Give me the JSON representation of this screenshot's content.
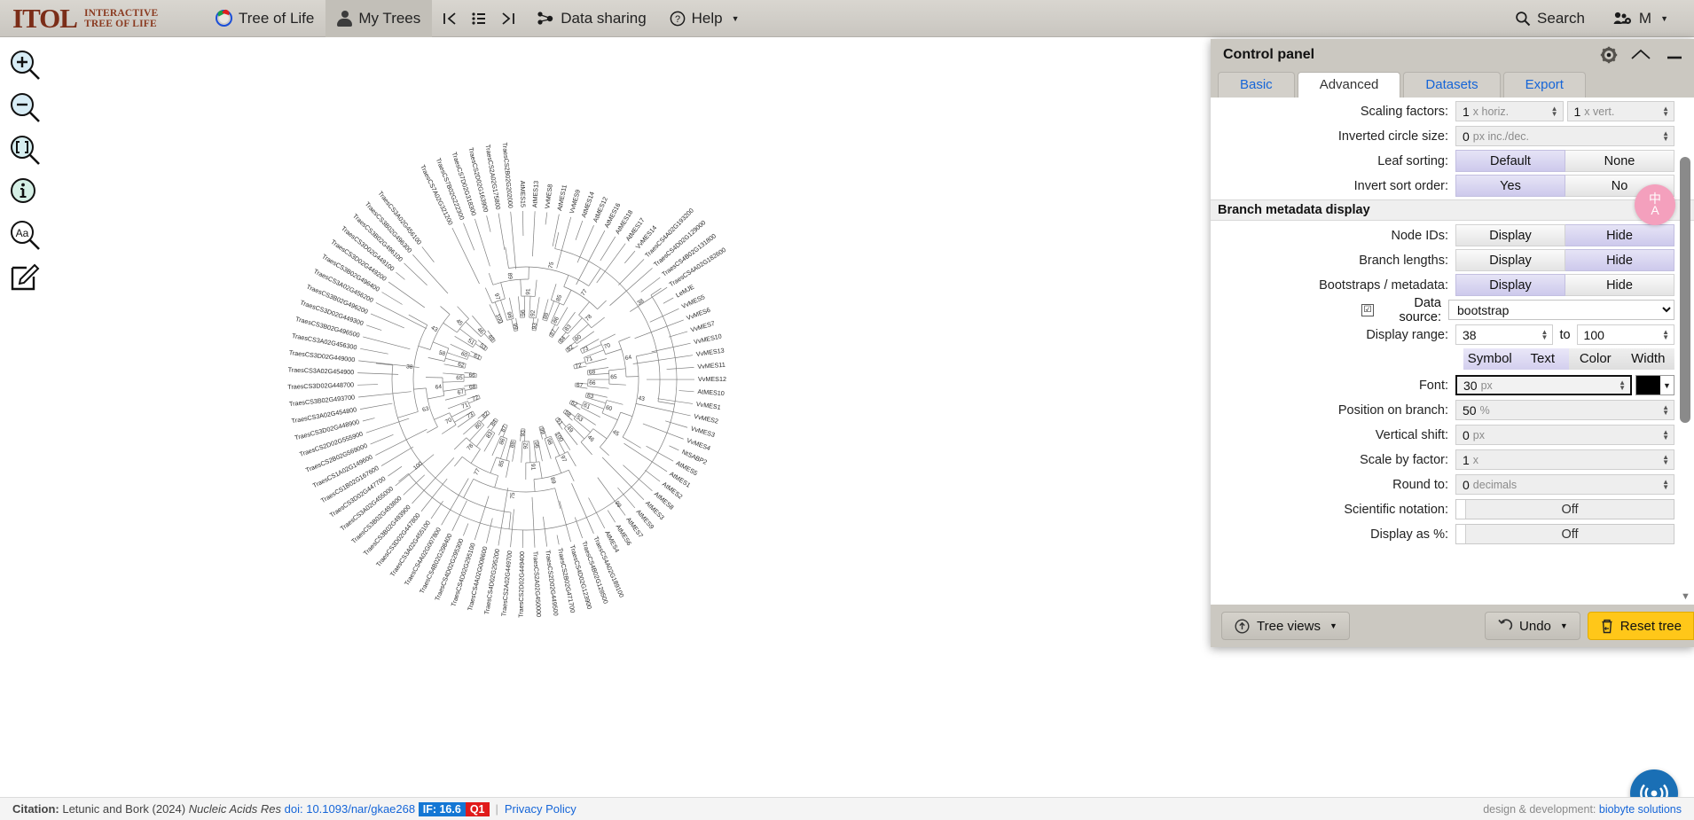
{
  "app": {
    "logo_main": "ITOL",
    "logo_line1": "INTERACTIVE",
    "logo_line2": "TREE OF LIFE"
  },
  "nav": {
    "items": [
      {
        "label": "Tree of Life",
        "icon": "tree-of-life-icon",
        "active": false
      },
      {
        "label": "My Trees",
        "icon": "person-icon",
        "active": true
      },
      {
        "label": "Data sharing",
        "icon": "share-nodes-icon",
        "active": false
      },
      {
        "label": "Help",
        "icon": "question-circle-icon",
        "active": false
      }
    ],
    "pager": {
      "first_label": "|←",
      "list_label": "☰",
      "last_label": "→|"
    },
    "search_label": "Search",
    "user_label": "M"
  },
  "left_tools": [
    {
      "name": "zoom-in-icon",
      "glyph": "+"
    },
    {
      "name": "zoom-out-icon",
      "glyph": "−"
    },
    {
      "name": "zoom-fit-icon",
      "glyph": "[ ]"
    },
    {
      "name": "info-icon",
      "glyph": "i"
    },
    {
      "name": "font-size-icon",
      "glyph": "Aa"
    },
    {
      "name": "annotate-icon",
      "glyph": "✎"
    }
  ],
  "control_panel": {
    "title": "Control panel",
    "header_icons": [
      "settings-gear-icon",
      "collapse-chevron-icon",
      "minimize-icon"
    ],
    "tabs": [
      {
        "label": "Basic",
        "active": false
      },
      {
        "label": "Advanced",
        "active": true
      },
      {
        "label": "Datasets",
        "active": false
      },
      {
        "label": "Export",
        "active": false
      }
    ],
    "rows": {
      "scaling_factors": {
        "label": "Scaling factors:",
        "horiz_value": "1",
        "horiz_unit": "x horiz.",
        "vert_value": "1",
        "vert_unit": "x vert."
      },
      "inverted_circle_size": {
        "label": "Inverted circle size:",
        "value": "0",
        "unit": "px inc./dec."
      },
      "leaf_sorting": {
        "label": "Leaf sorting:",
        "options": [
          "Default",
          "None"
        ],
        "selected": "Default"
      },
      "invert_sort_order": {
        "label": "Invert sort order:",
        "options": [
          "Yes",
          "No"
        ],
        "selected": "Yes"
      }
    },
    "branch_metadata": {
      "section_title": "Branch metadata display",
      "node_ids": {
        "label": "Node IDs:",
        "options": [
          "Display",
          "Hide"
        ],
        "selected": "Hide"
      },
      "branch_lengths": {
        "label": "Branch lengths:",
        "options": [
          "Display",
          "Hide"
        ],
        "selected": "Hide"
      },
      "bootstraps": {
        "label": "Bootstraps / metadata:",
        "options": [
          "Display",
          "Hide"
        ],
        "selected": "Display"
      },
      "data_source": {
        "label": "Data source:",
        "checkbox_checked": true,
        "value": "bootstrap",
        "options": [
          "bootstrap"
        ]
      },
      "display_range": {
        "label": "Display range:",
        "from": "38",
        "to_label": "to",
        "to": "100"
      },
      "style_tabs": {
        "items": [
          "Symbol",
          "Text",
          "Color",
          "Width"
        ],
        "selected": "Text"
      },
      "font": {
        "label": "Font:",
        "value": "30",
        "unit": "px",
        "color": "#000000"
      },
      "position_on_branch": {
        "label": "Position on branch:",
        "value": "50",
        "unit": "%"
      },
      "vertical_shift": {
        "label": "Vertical shift:",
        "value": "0",
        "unit": "px"
      },
      "scale_by_factor": {
        "label": "Scale by factor:",
        "value": "1",
        "unit": "x"
      },
      "round_to": {
        "label": "Round to:",
        "value": "0",
        "unit": "decimals"
      },
      "scientific_notation": {
        "label": "Scientific notation:",
        "value": "Off"
      },
      "display_as_percent": {
        "label": "Display as %:",
        "value": "Off"
      }
    },
    "footer": {
      "tree_views": "Tree views",
      "undo": "Undo",
      "reset": "Reset tree"
    }
  },
  "floating": {
    "translate_icon": "translate-icon",
    "translate_glyph_top": "中",
    "translate_glyph_bottom": "A",
    "chat_icon": "live-support-icon"
  },
  "footer": {
    "citation_label": "Citation:",
    "citation_text": "Letunic and Bork (2024)",
    "journal": "Nucleic Acids Res",
    "doi": "doi: 10.1093/nar/gkae268",
    "if_badge": "IF: 16.6",
    "q_badge": "Q1",
    "privacy": "Privacy Policy",
    "design_label": "design & development:",
    "design_link": "biobyte solutions"
  },
  "tree": {
    "type": "circular-phylogram",
    "bootstrap_display_min": 38,
    "bootstrap_display_max": 100,
    "leaves": [
      "TraesCS7A02G321200",
      "TraesCS7B02G222300",
      "TraesCS7D02G318300",
      "TraesCS2D02G163900",
      "TraesCS2A02G175800",
      "TraesCS2B02G202000",
      "AtMES15",
      "AtMES13",
      "VvMES8",
      "AtMES11",
      "VvMES9",
      "AtMES14",
      "AtMES12",
      "AtMES16",
      "AtMES18",
      "AtMES17",
      "VvMES14",
      "TraesCS4A02G193200",
      "TraesCS4D02G129000",
      "TraesCS4B02G131800",
      "TraesCS4A02G182600",
      "LeMJE",
      "VvMES5",
      "VvMES6",
      "VvMES7",
      "VvMES10",
      "VvMES13",
      "VvMES11",
      "VvMES12",
      "AtMES10",
      "VvMES1",
      "VvMES2",
      "VvMES3",
      "VvMES4",
      "NtSABP2",
      "AtMES5",
      "AtMES1",
      "AtMES2",
      "AtMES8",
      "AtMES3",
      "AtMES9",
      "AtMES7",
      "AtMES6",
      "AtMES4",
      "TraesCS4A02G189100",
      "TraesCS4B02G128500",
      "TraesCS4D02G123900",
      "TraesCS2B02G471700",
      "TraesCS2D02G449500",
      "TraesCS2A02G450000",
      "TraesCS2D02G449400",
      "TraesCS2A02G449700",
      "TraesCS4D02G295200",
      "TraesCS4A02G008600",
      "TraesCS4D02G295100",
      "TraesCS4D02G295300",
      "TraesCS4B02G298400",
      "TraesCS4A02G007800",
      "TraesCS3A02G455100",
      "TraesCS3D02G447800",
      "TraesCS3B02G493900",
      "TraesCS3B02G493800",
      "TraesCS3A02G455000",
      "TraesCS3D02G447700",
      "TraesCS1B02G167600",
      "TraesCS1A02G149600",
      "TraesCS2B02G569000",
      "TraesCS2D02G555900",
      "TraesCS3D02G448900",
      "TraesCS3A02G454800",
      "TraesCS3B02G493700",
      "TraesCS3D02G448700",
      "TraesCS3A02G454900",
      "TraesCS3D02G449000",
      "TraesCS3A02G456300",
      "TraesCS3B02G496500",
      "TraesCS3D02G449300",
      "TraesCS3B02G496200",
      "TraesCS3A02G456200",
      "TraesCS3B02G496400",
      "TraesCS3D02G449200",
      "TraesCS3D02G449100",
      "TraesCS3B02G496100",
      "TraesCS3B02G496300",
      "TraesCS3A02G456100"
    ],
    "bootstrap_values": [
      100,
      99,
      98,
      97,
      96,
      93,
      92,
      91,
      89,
      88,
      87,
      86,
      85,
      84,
      83,
      82,
      80,
      78,
      77,
      75,
      73,
      72,
      71,
      70,
      68,
      67,
      66,
      65,
      64,
      63,
      62,
      61,
      60,
      58,
      53,
      51,
      49,
      46,
      45,
      43,
      38
    ]
  }
}
